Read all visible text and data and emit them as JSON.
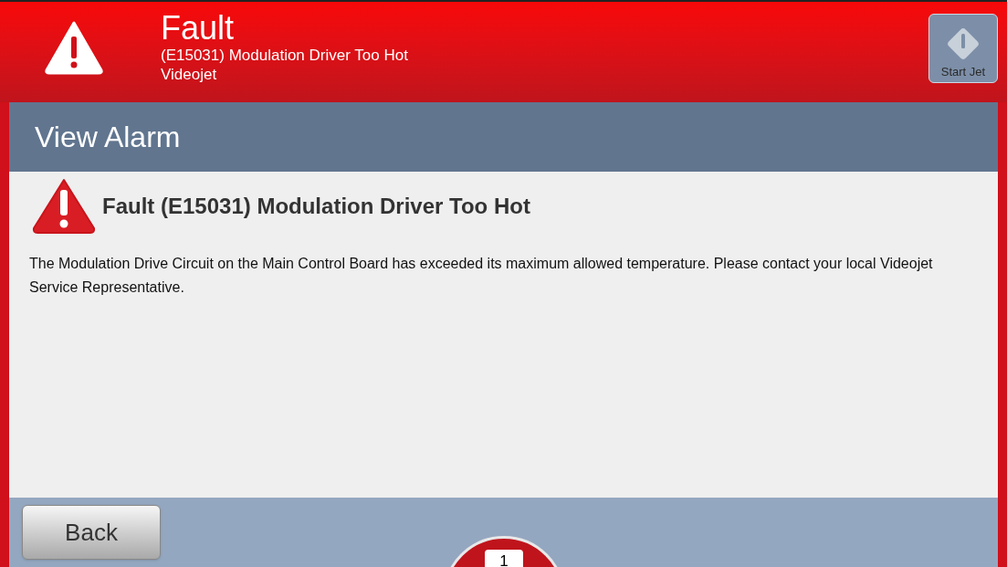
{
  "header": {
    "title": "Fault",
    "subtitle": "(E15031) Modulation Driver Too Hot",
    "source": "Videojet",
    "start_jet": {
      "label": "Start Jet",
      "disabled": true
    }
  },
  "page_title": "View Alarm",
  "alarm": {
    "heading": "Fault (E15031) Modulation Driver Too Hot",
    "description": "The Modulation Drive Circuit on the Main Control Board has exceeded its maximum allowed temperature. Please contact your local Videojet Service Representative."
  },
  "footer": {
    "back_button": "Back",
    "alarm_count": "1"
  }
}
